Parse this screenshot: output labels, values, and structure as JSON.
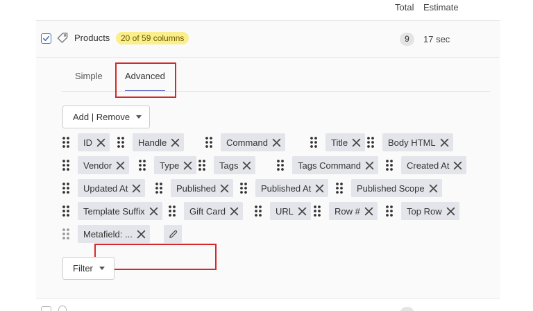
{
  "header": {
    "total_label": "Total",
    "estimate_label": "Estimate"
  },
  "sheet": {
    "checked": true,
    "name": "Products",
    "columns_badge": "20 of 59 columns",
    "total": "9",
    "estimate": "17 sec"
  },
  "tabs": [
    {
      "label": "Simple",
      "active": false
    },
    {
      "label": "Advanced",
      "active": true
    }
  ],
  "add_remove_label": "Add | Remove",
  "filter_label": "Filter",
  "columns": [
    {
      "label": "ID"
    },
    {
      "label": "Handle"
    },
    {
      "label": "Command"
    },
    {
      "label": "Title"
    },
    {
      "label": "Body HTML"
    },
    {
      "label": "Vendor"
    },
    {
      "label": "Type"
    },
    {
      "label": "Tags"
    },
    {
      "label": "Tags Command"
    },
    {
      "label": "Created At"
    },
    {
      "label": "Updated At"
    },
    {
      "label": "Published"
    },
    {
      "label": "Published At"
    },
    {
      "label": "Published Scope"
    },
    {
      "label": "Template Suffix"
    },
    {
      "label": "Gift Card"
    },
    {
      "label": "URL"
    },
    {
      "label": "Row #"
    },
    {
      "label": "Top Row"
    },
    {
      "label": "Metafield: ..."
    }
  ],
  "colors": {
    "accent": "#5b63c7",
    "badge_yellow": "#fbee8c",
    "chip_bg": "#e3e5ea",
    "highlight": "#d62828"
  }
}
